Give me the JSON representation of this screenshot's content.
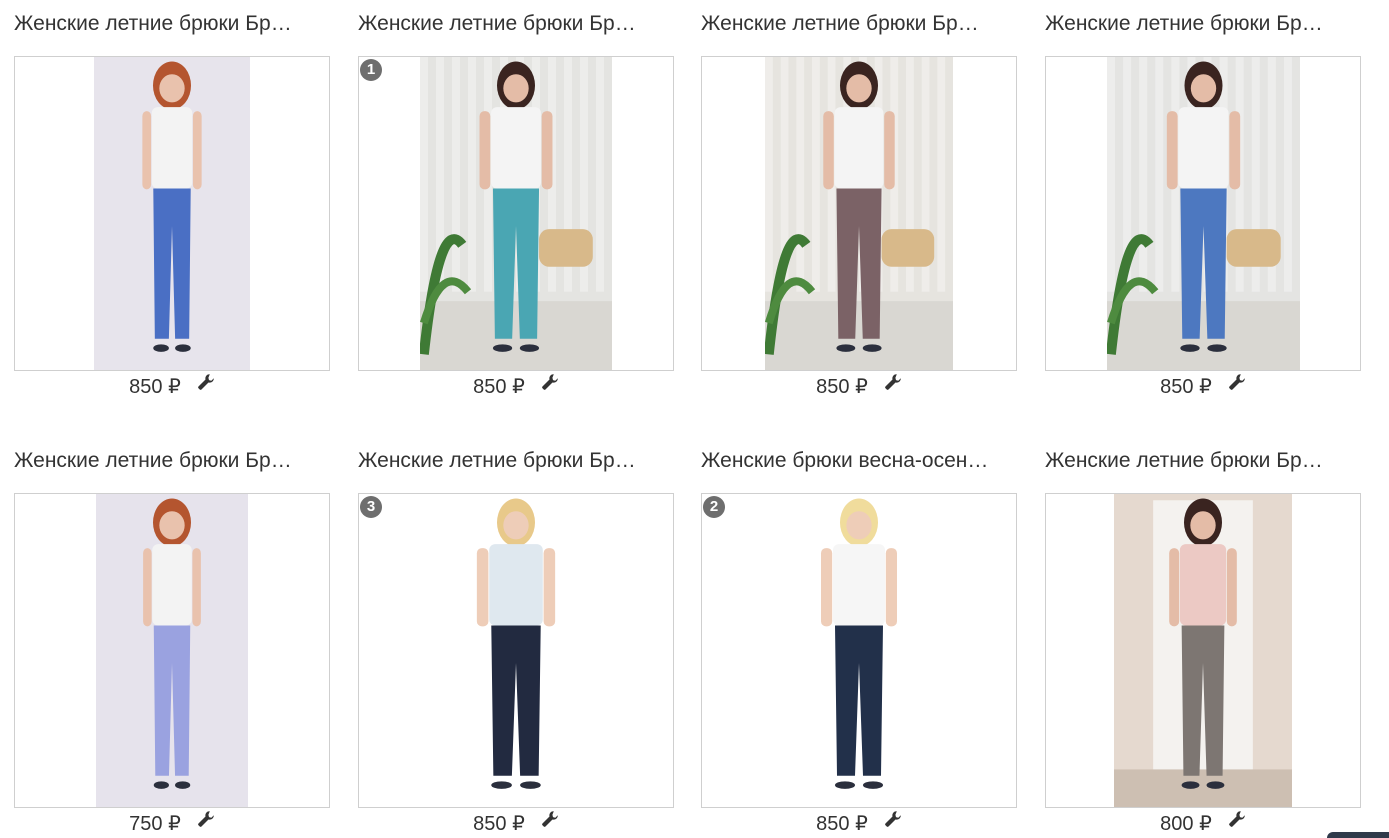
{
  "products": [
    {
      "title": "Женские летние брюки Бр…",
      "price": "850 ₽",
      "badge": "",
      "photo": {
        "bg": "#e7e4ec",
        "top": "#f3f3f3",
        "pants": "#4a6fc4",
        "skin": "#e9c2ad",
        "hair": "#b4552f",
        "scene": "studio"
      }
    },
    {
      "title": "Женские летние брюки Бр…",
      "price": "850 ₽",
      "badge": "1",
      "photo": {
        "bg": "#e4e4e1",
        "top": "#f4f4f4",
        "pants": "#4aa6b3",
        "skin": "#e4bca7",
        "hair": "#3a2420",
        "scene": "room"
      }
    },
    {
      "title": "Женские летние брюки Бр…",
      "price": "850 ₽",
      "badge": "",
      "photo": {
        "bg": "#e6e4df",
        "top": "#f4f4f4",
        "pants": "#7b6266",
        "skin": "#e4bca7",
        "hair": "#3a2420",
        "scene": "room"
      }
    },
    {
      "title": "Женские летние брюки Бр…",
      "price": "850 ₽",
      "badge": "",
      "photo": {
        "bg": "#e4e4e2",
        "top": "#f4f4f4",
        "pants": "#4d78c0",
        "skin": "#e4bca7",
        "hair": "#3a2420",
        "scene": "room"
      }
    },
    {
      "title": "Женские летние брюки Бр…",
      "price": "750 ₽",
      "badge": "",
      "photo": {
        "bg": "#e6e3ec",
        "top": "#f3f3f3",
        "pants": "#9aa2e0",
        "skin": "#e9c2ad",
        "hair": "#b4552f",
        "scene": "studio"
      }
    },
    {
      "title": "Женские летние брюки Бр…",
      "price": "850 ₽",
      "badge": "3",
      "photo": {
        "bg": "#ffffff",
        "top": "#dfe8ef",
        "pants": "#222a40",
        "skin": "#eecdb8",
        "hair": "#e8c98a",
        "scene": "white"
      }
    },
    {
      "title": "Женские брюки весна-осен…",
      "price": "850 ₽",
      "badge": "2",
      "photo": {
        "bg": "#ffffff",
        "top": "#f6f6f6",
        "pants": "#22304a",
        "skin": "#eecdb8",
        "hair": "#f0dc9c",
        "scene": "white"
      }
    },
    {
      "title": "Женские летние брюки Бр…",
      "price": "800 ₽",
      "badge": "",
      "photo": {
        "bg": "#e5d9cf",
        "top": "#ecc9c4",
        "pants": "#7d7672",
        "skin": "#e4bca7",
        "hair": "#3a2420",
        "scene": "door"
      }
    }
  ],
  "icons": {
    "edit": "wrench-icon",
    "badge": "number-badge"
  }
}
